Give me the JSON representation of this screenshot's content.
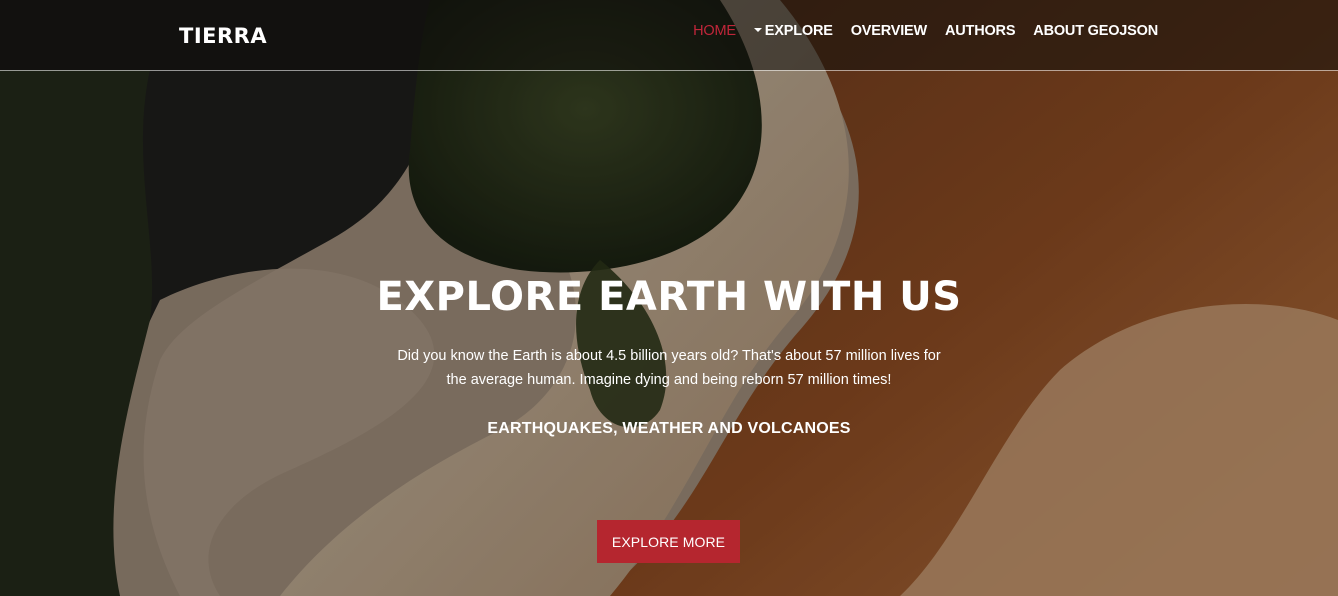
{
  "brand": "TIERRA",
  "nav": {
    "home": "HOME",
    "explore": "EXPLORE",
    "overview": "OVERVIEW",
    "authors": "AUTHORS",
    "about": "ABOUT GEOJSON"
  },
  "hero": {
    "headline": "EXPLORE EARTH WITH US",
    "description": "Did you know the Earth is about 4.5 billion years old? That's about 57 million lives for the average human. Imagine dying and being reborn 57 million times!",
    "subtitle": "EARTHQUAKES, WEATHER AND VOLCANOES",
    "cta_label": "EXPLORE MORE"
  },
  "colors": {
    "accent": "#b5262f",
    "active_nav": "#c0263a",
    "text": "#ffffff"
  },
  "icons": {
    "dropdown": "caret-down-icon"
  }
}
